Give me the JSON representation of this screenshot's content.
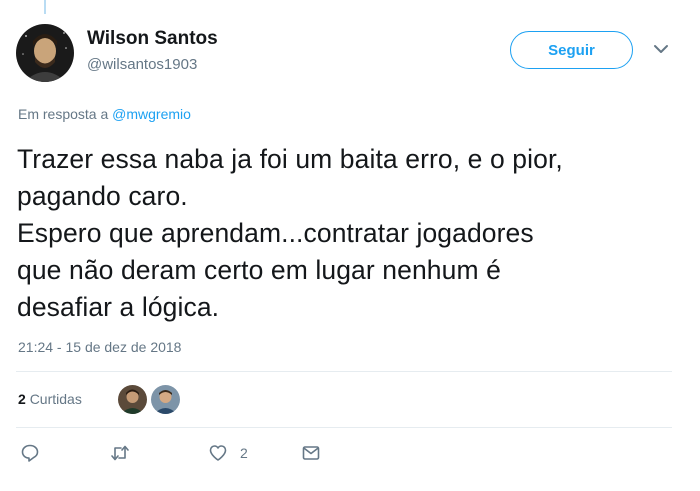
{
  "tweet": {
    "author_name": "Wilson Santos",
    "author_handle": "@wilsantos1903",
    "follow_label": "Seguir",
    "reply_prefix": "Em resposta a ",
    "reply_to": "@mwgremio",
    "text_lines": [
      "Trazer essa naba ja foi um baita erro, e o pior,",
      "pagando caro.",
      "Espero que aprendam...contratar jogadores",
      "que não deram certo em lugar nenhum é",
      "desafiar a lógica."
    ],
    "timestamp": "21:24 - 15 de dez de 2018",
    "likes_count": "2",
    "likes_label": "Curtidas"
  },
  "actions": {
    "reply_count": "",
    "retweet_count": "",
    "like_count": "2"
  },
  "icons": [
    "reply-icon",
    "retweet-icon",
    "heart-icon",
    "dm-icon",
    "chevron-down-icon"
  ],
  "colors": {
    "accent": "#1da1f2",
    "secondary_text": "#657786",
    "primary_text": "#14171a",
    "divider": "#e6ecf0"
  }
}
